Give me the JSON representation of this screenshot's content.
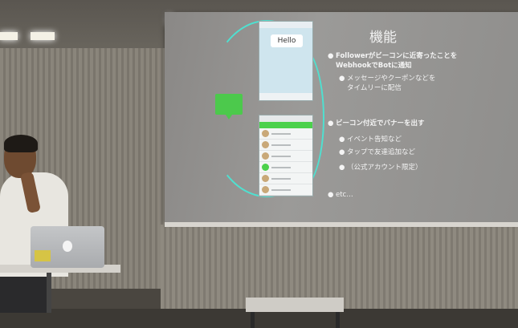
{
  "slide": {
    "title": "機能",
    "bullets": [
      {
        "level": 1,
        "text": "Followerがビーコンに近寄ったことを"
      },
      {
        "level": 1,
        "text": "WebhookでBotに通知"
      },
      {
        "level": 2,
        "text": "メッセージやクーポンなどを"
      },
      {
        "level": 2,
        "text": "タイムリーに配信"
      },
      {
        "level": 1,
        "text": "ビーコン付近でバナーを出す"
      },
      {
        "level": 2,
        "text": "イベント告知など"
      },
      {
        "level": 2,
        "text": "タップで友達追加など"
      },
      {
        "level": 2,
        "text": "（公式アカウント限定）"
      },
      {
        "level": 1,
        "text": "etc…"
      }
    ]
  },
  "phone_mockup": {
    "bubble_text": "Hello"
  },
  "colors": {
    "accent_arc": "#4fe0d0",
    "line_green": "#4cc94c",
    "screen": "#9b9a98"
  }
}
